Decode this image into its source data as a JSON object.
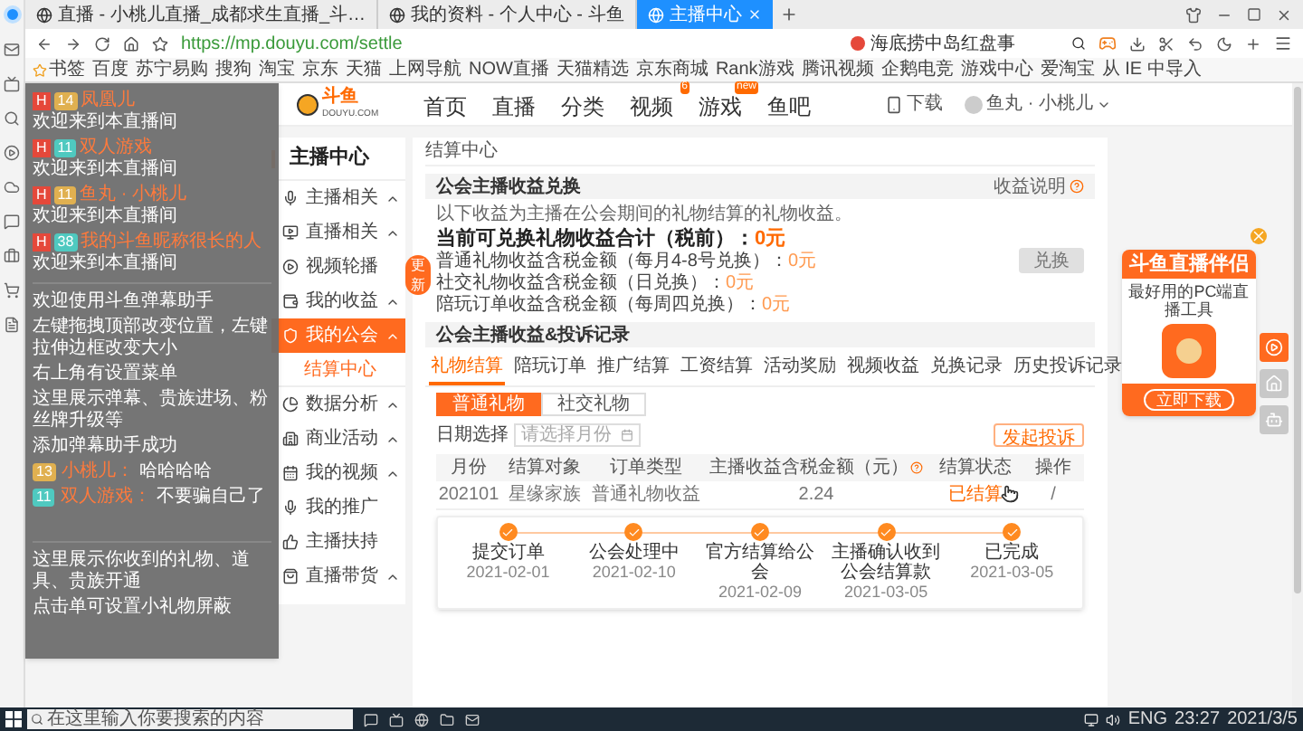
{
  "browser": {
    "tabs": [
      {
        "title": "直播 - 小桃儿直播_成都求生直播_斗…",
        "selected": false
      },
      {
        "title": "我的资料 - 个人中心 - 斗鱼",
        "selected": false
      },
      {
        "title": "主播中心",
        "selected": true
      }
    ],
    "address": "https://mp.douyu.com/settle",
    "search": {
      "value": "海底捞中岛红盘事"
    },
    "bookmarks": [
      "书签",
      "百度",
      "苏宁易购",
      "搜狗",
      "淘宝",
      "京东",
      "天猫",
      "上网导航",
      "NOW直播",
      "天猫精选",
      "京东商城",
      "Rank游戏",
      "腾讯视频",
      "企鹅电竞",
      "游戏中心",
      "爱淘宝",
      "从 IE 中导入"
    ]
  },
  "site_nav": {
    "logo": "斗鱼",
    "logo_sub": "DOUYU.COM",
    "items": [
      {
        "label": "首页"
      },
      {
        "label": "直播"
      },
      {
        "label": "分类"
      },
      {
        "label": "视频",
        "badge": "6"
      },
      {
        "label": "游戏",
        "badge": "new"
      },
      {
        "label": "鱼吧"
      }
    ],
    "download": "下载",
    "user": "鱼丸 · 小桃儿"
  },
  "side_menu": {
    "title": "主播中心",
    "items": [
      {
        "label": "主播相关",
        "kind": "group",
        "selected": false
      },
      {
        "label": "直播相关",
        "kind": "group",
        "selected": false
      },
      {
        "label": "视频轮播",
        "kind": "link",
        "selected": false,
        "badge": "更新"
      },
      {
        "label": "我的收益",
        "kind": "group",
        "selected": false
      },
      {
        "label": "我的公会",
        "kind": "group",
        "selected": true,
        "children": [
          {
            "label": "结算中心",
            "selected": true
          }
        ]
      },
      {
        "label": "数据分析",
        "kind": "group",
        "selected": false
      },
      {
        "label": "商业活动",
        "kind": "group",
        "selected": false
      },
      {
        "label": "我的视频",
        "kind": "group",
        "selected": false
      },
      {
        "label": "我的推广",
        "kind": "link",
        "selected": false
      },
      {
        "label": "主播扶持",
        "kind": "link",
        "selected": false
      },
      {
        "label": "直播带货",
        "kind": "group",
        "selected": false
      }
    ]
  },
  "main": {
    "breadcrumb": "结算中心",
    "exchange": {
      "title": "公会主播收益兑换",
      "help": "收益说明",
      "note": "以下收益为主播在公会期间的礼物结算的礼物收益。",
      "total_label": "当前可兑换礼物收益合计（税前）：",
      "total_value": "0元",
      "lines": [
        {
          "label": "普通礼物收益含税金额（每月4-8号兑换）：",
          "value": "0元"
        },
        {
          "label": "社交礼物收益含税金额（日兑换）：",
          "value": "0元"
        },
        {
          "label": "陪玩订单收益含税金额（每周四兑换）：",
          "value": "0元"
        }
      ],
      "button": {
        "label": "兑换",
        "disabled": true
      }
    },
    "records": {
      "title": "公会主播收益&投诉记录",
      "tabs": [
        {
          "label": "礼物结算",
          "selected": true
        },
        {
          "label": "陪玩订单",
          "selected": false
        },
        {
          "label": "推广结算",
          "selected": false
        },
        {
          "label": "工资结算",
          "selected": false
        },
        {
          "label": "活动奖励",
          "selected": false
        },
        {
          "label": "视频收益",
          "selected": false
        },
        {
          "label": "兑换记录",
          "selected": false
        },
        {
          "label": "历史投诉记录",
          "selected": false
        }
      ],
      "segments": [
        {
          "label": "普通礼物",
          "selected": true
        },
        {
          "label": "社交礼物",
          "selected": false
        }
      ],
      "date_label": "日期选择",
      "date_placeholder": "请选择月份",
      "complain": "发起投诉",
      "columns": [
        "月份",
        "结算对象",
        "订单类型",
        "主播收益含税金额（元）",
        "结算状态",
        "操作"
      ],
      "rows": [
        {
          "cells": [
            "202101",
            "星缘家族",
            "普通礼物收益",
            "2.24",
            "已结算",
            "/"
          ]
        }
      ],
      "steps": [
        {
          "label": "提交订单",
          "date": "2021-02-01",
          "done": true
        },
        {
          "label": "公会处理中",
          "date": "2021-02-10",
          "done": true
        },
        {
          "label": "官方结算给公会",
          "date": "2021-02-09",
          "done": true
        },
        {
          "label": "主播确认收到公会结算款",
          "date": "2021-03-05",
          "done": true
        },
        {
          "label": "已完成",
          "date": "2021-03-05",
          "done": true
        }
      ]
    }
  },
  "promo": {
    "title": "斗鱼直播伴侣",
    "subtitle": "最好用的PC端直播工具",
    "button": "立即下载"
  },
  "overlay": {
    "messages": [
      {
        "badge": "H",
        "level": "14",
        "color": "#e0b050",
        "name": "凤凰儿",
        "text": "欢迎来到本直播间"
      },
      {
        "badge": "H",
        "level": "11",
        "color": "#4fc9c0",
        "name": "双人游戏",
        "text": "欢迎来到本直播间"
      },
      {
        "badge": "H",
        "level": "11",
        "color": "#e0b050",
        "name": "鱼丸 · 小桃儿",
        "text": "欢迎来到本直播间"
      },
      {
        "badge": "H",
        "level": "38",
        "color": "#4fc9c0",
        "name": "我的斗鱼昵称很长的人",
        "text": "欢迎来到本直播间"
      }
    ],
    "notices": [
      "欢迎使用斗鱼弹幕助手",
      "左键拖拽顶部改变位置，左键拉伸边框改变大小",
      "右上角有设置菜单",
      "这里展示弹幕、贵族进场、粉丝牌升级等",
      "添加弹幕助手成功"
    ],
    "chats": [
      {
        "level": "13",
        "color": "#e0b050",
        "name": "小桃儿：",
        "text": "哈哈哈哈"
      },
      {
        "level": "11",
        "color": "#4fc9c0",
        "name": "双人游戏：",
        "text": "不要骗自己了"
      }
    ],
    "gift_notes": [
      "这里展示你收到的礼物、道具、贵族开通",
      "点击单可设置小礼物屏蔽"
    ]
  },
  "taskbar": {
    "search_placeholder": "在这里输入你要搜索的内容",
    "lang": "ENG",
    "time": "23:27",
    "date": "2021/3/5"
  }
}
